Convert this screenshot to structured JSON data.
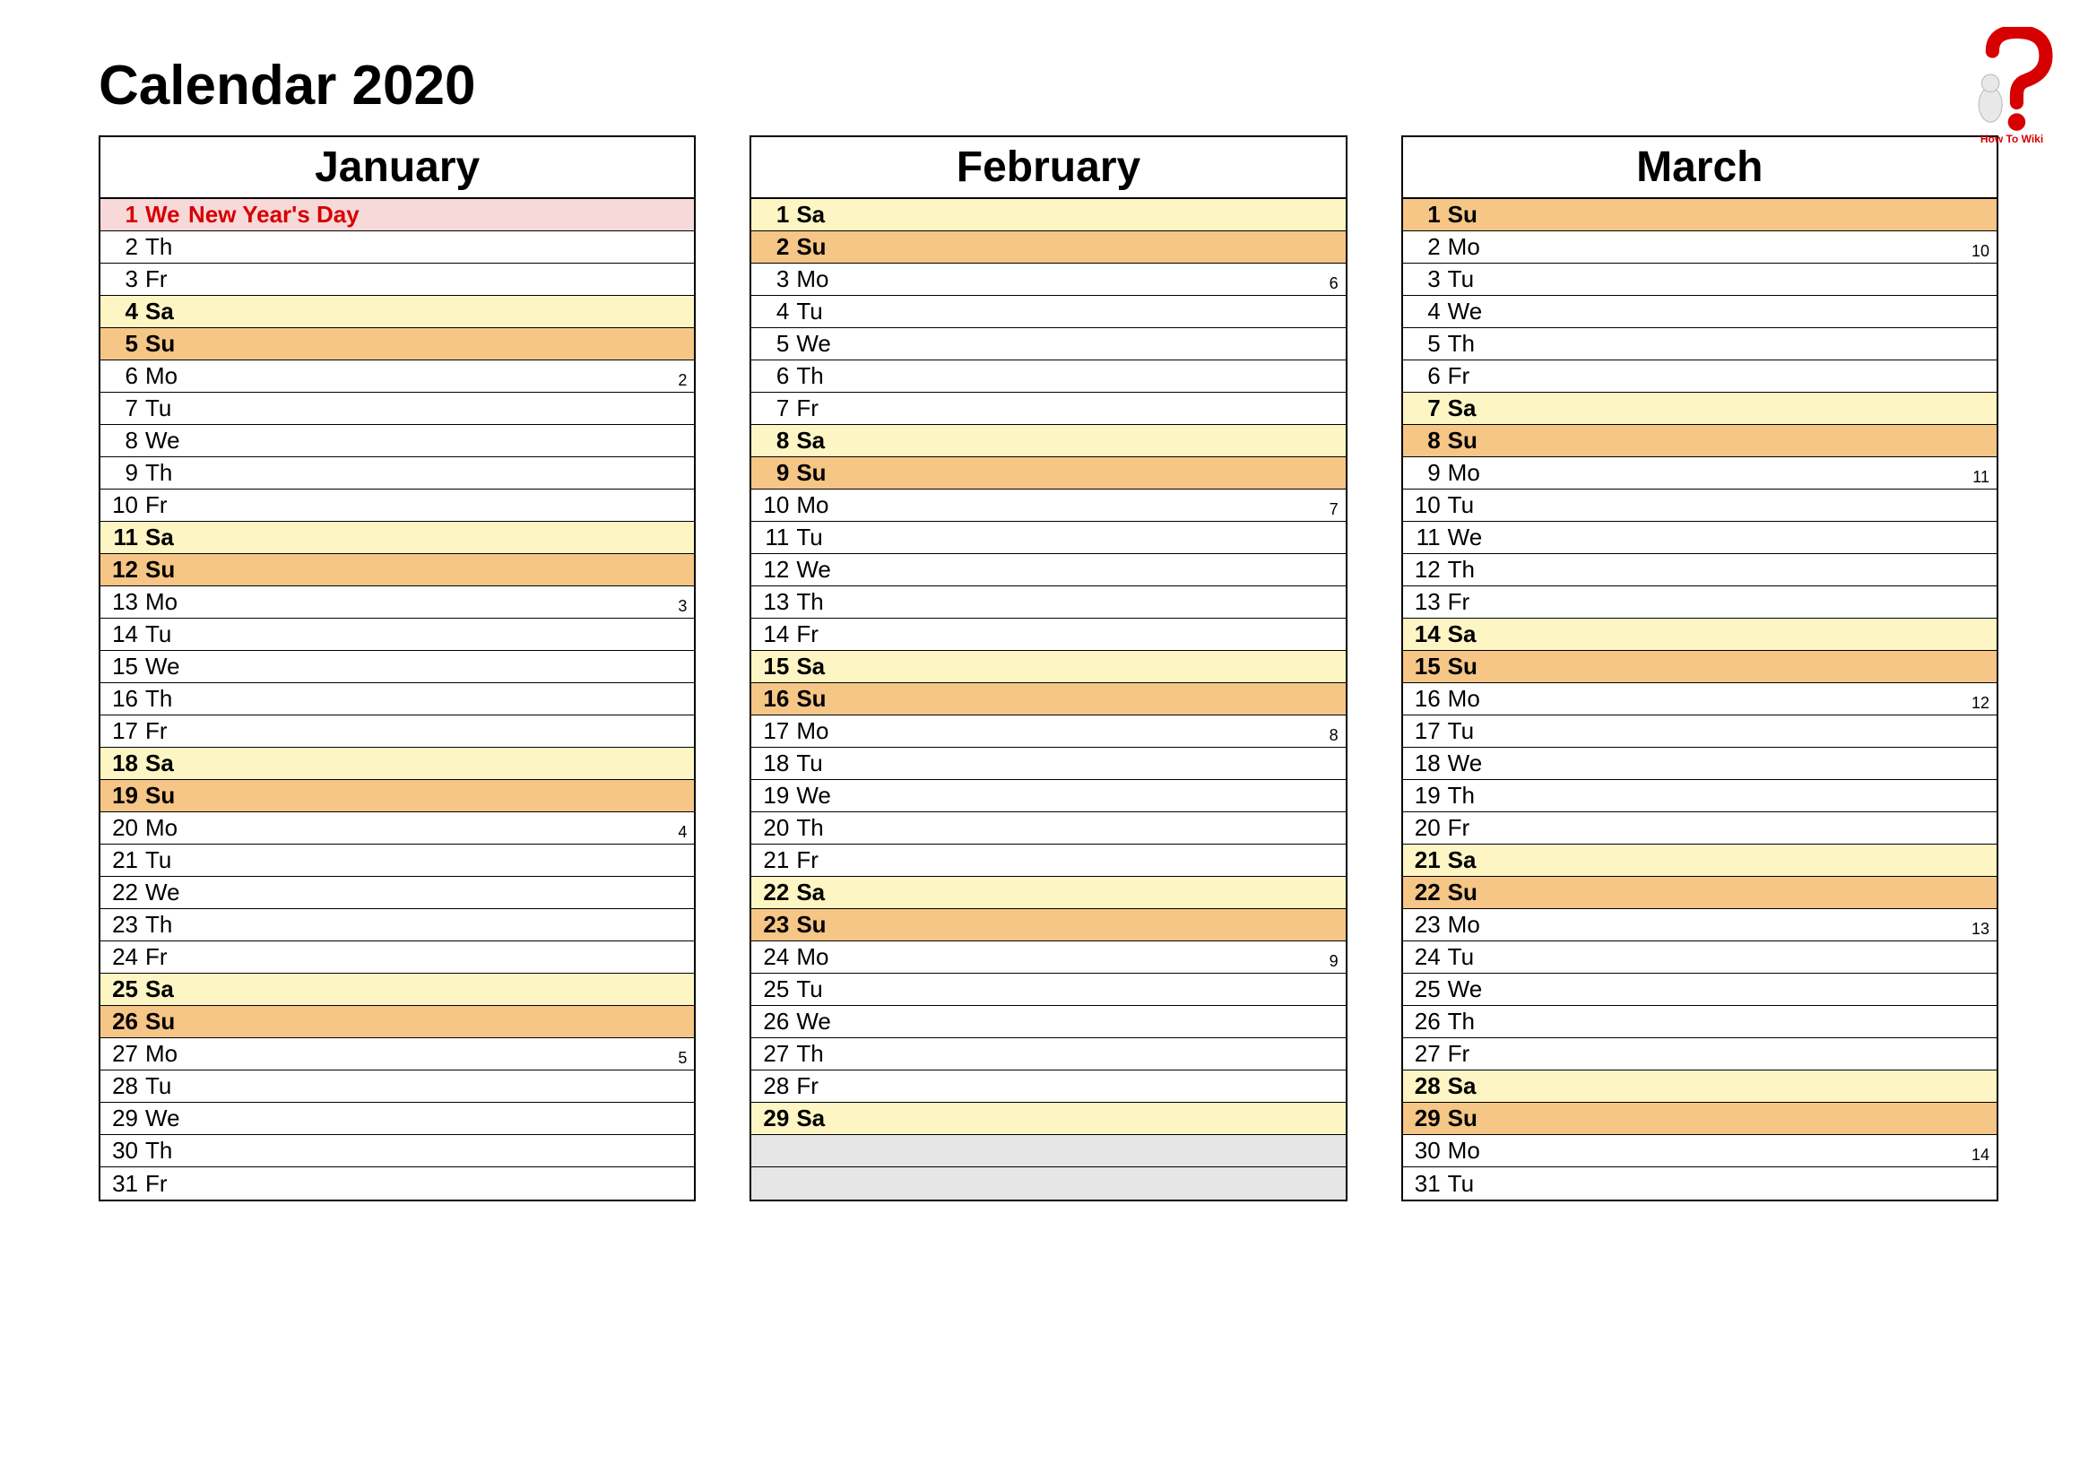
{
  "title": "Calendar 2020",
  "logo_caption": "How To Wiki",
  "months": [
    {
      "name": "January",
      "days": [
        {
          "n": "1",
          "wd": "We",
          "holiday": "New Year's Day",
          "type": "hol",
          "wk": ""
        },
        {
          "n": "2",
          "wd": "Th",
          "holiday": "",
          "type": "",
          "wk": ""
        },
        {
          "n": "3",
          "wd": "Fr",
          "holiday": "",
          "type": "",
          "wk": ""
        },
        {
          "n": "4",
          "wd": "Sa",
          "holiday": "",
          "type": "sa",
          "wk": ""
        },
        {
          "n": "5",
          "wd": "Su",
          "holiday": "",
          "type": "su",
          "wk": ""
        },
        {
          "n": "6",
          "wd": "Mo",
          "holiday": "",
          "type": "",
          "wk": "2"
        },
        {
          "n": "7",
          "wd": "Tu",
          "holiday": "",
          "type": "",
          "wk": ""
        },
        {
          "n": "8",
          "wd": "We",
          "holiday": "",
          "type": "",
          "wk": ""
        },
        {
          "n": "9",
          "wd": "Th",
          "holiday": "",
          "type": "",
          "wk": ""
        },
        {
          "n": "10",
          "wd": "Fr",
          "holiday": "",
          "type": "",
          "wk": ""
        },
        {
          "n": "11",
          "wd": "Sa",
          "holiday": "",
          "type": "sa",
          "wk": ""
        },
        {
          "n": "12",
          "wd": "Su",
          "holiday": "",
          "type": "su",
          "wk": ""
        },
        {
          "n": "13",
          "wd": "Mo",
          "holiday": "",
          "type": "",
          "wk": "3"
        },
        {
          "n": "14",
          "wd": "Tu",
          "holiday": "",
          "type": "",
          "wk": ""
        },
        {
          "n": "15",
          "wd": "We",
          "holiday": "",
          "type": "",
          "wk": ""
        },
        {
          "n": "16",
          "wd": "Th",
          "holiday": "",
          "type": "",
          "wk": ""
        },
        {
          "n": "17",
          "wd": "Fr",
          "holiday": "",
          "type": "",
          "wk": ""
        },
        {
          "n": "18",
          "wd": "Sa",
          "holiday": "",
          "type": "sa",
          "wk": ""
        },
        {
          "n": "19",
          "wd": "Su",
          "holiday": "",
          "type": "su",
          "wk": ""
        },
        {
          "n": "20",
          "wd": "Mo",
          "holiday": "",
          "type": "",
          "wk": "4"
        },
        {
          "n": "21",
          "wd": "Tu",
          "holiday": "",
          "type": "",
          "wk": ""
        },
        {
          "n": "22",
          "wd": "We",
          "holiday": "",
          "type": "",
          "wk": ""
        },
        {
          "n": "23",
          "wd": "Th",
          "holiday": "",
          "type": "",
          "wk": ""
        },
        {
          "n": "24",
          "wd": "Fr",
          "holiday": "",
          "type": "",
          "wk": ""
        },
        {
          "n": "25",
          "wd": "Sa",
          "holiday": "",
          "type": "sa",
          "wk": ""
        },
        {
          "n": "26",
          "wd": "Su",
          "holiday": "",
          "type": "su",
          "wk": ""
        },
        {
          "n": "27",
          "wd": "Mo",
          "holiday": "",
          "type": "",
          "wk": "5"
        },
        {
          "n": "28",
          "wd": "Tu",
          "holiday": "",
          "type": "",
          "wk": ""
        },
        {
          "n": "29",
          "wd": "We",
          "holiday": "",
          "type": "",
          "wk": ""
        },
        {
          "n": "30",
          "wd": "Th",
          "holiday": "",
          "type": "",
          "wk": ""
        },
        {
          "n": "31",
          "wd": "Fr",
          "holiday": "",
          "type": "",
          "wk": ""
        }
      ]
    },
    {
      "name": "February",
      "days": [
        {
          "n": "1",
          "wd": "Sa",
          "holiday": "",
          "type": "sa",
          "wk": ""
        },
        {
          "n": "2",
          "wd": "Su",
          "holiday": "",
          "type": "su",
          "wk": ""
        },
        {
          "n": "3",
          "wd": "Mo",
          "holiday": "",
          "type": "",
          "wk": "6"
        },
        {
          "n": "4",
          "wd": "Tu",
          "holiday": "",
          "type": "",
          "wk": ""
        },
        {
          "n": "5",
          "wd": "We",
          "holiday": "",
          "type": "",
          "wk": ""
        },
        {
          "n": "6",
          "wd": "Th",
          "holiday": "",
          "type": "",
          "wk": ""
        },
        {
          "n": "7",
          "wd": "Fr",
          "holiday": "",
          "type": "",
          "wk": ""
        },
        {
          "n": "8",
          "wd": "Sa",
          "holiday": "",
          "type": "sa",
          "wk": ""
        },
        {
          "n": "9",
          "wd": "Su",
          "holiday": "",
          "type": "su",
          "wk": ""
        },
        {
          "n": "10",
          "wd": "Mo",
          "holiday": "",
          "type": "",
          "wk": "7"
        },
        {
          "n": "11",
          "wd": "Tu",
          "holiday": "",
          "type": "",
          "wk": ""
        },
        {
          "n": "12",
          "wd": "We",
          "holiday": "",
          "type": "",
          "wk": ""
        },
        {
          "n": "13",
          "wd": "Th",
          "holiday": "",
          "type": "",
          "wk": ""
        },
        {
          "n": "14",
          "wd": "Fr",
          "holiday": "",
          "type": "",
          "wk": ""
        },
        {
          "n": "15",
          "wd": "Sa",
          "holiday": "",
          "type": "sa",
          "wk": ""
        },
        {
          "n": "16",
          "wd": "Su",
          "holiday": "",
          "type": "su",
          "wk": ""
        },
        {
          "n": "17",
          "wd": "Mo",
          "holiday": "",
          "type": "",
          "wk": "8"
        },
        {
          "n": "18",
          "wd": "Tu",
          "holiday": "",
          "type": "",
          "wk": ""
        },
        {
          "n": "19",
          "wd": "We",
          "holiday": "",
          "type": "",
          "wk": ""
        },
        {
          "n": "20",
          "wd": "Th",
          "holiday": "",
          "type": "",
          "wk": ""
        },
        {
          "n": "21",
          "wd": "Fr",
          "holiday": "",
          "type": "",
          "wk": ""
        },
        {
          "n": "22",
          "wd": "Sa",
          "holiday": "",
          "type": "sa",
          "wk": ""
        },
        {
          "n": "23",
          "wd": "Su",
          "holiday": "",
          "type": "su",
          "wk": ""
        },
        {
          "n": "24",
          "wd": "Mo",
          "holiday": "",
          "type": "",
          "wk": "9"
        },
        {
          "n": "25",
          "wd": "Tu",
          "holiday": "",
          "type": "",
          "wk": ""
        },
        {
          "n": "26",
          "wd": "We",
          "holiday": "",
          "type": "",
          "wk": ""
        },
        {
          "n": "27",
          "wd": "Th",
          "holiday": "",
          "type": "",
          "wk": ""
        },
        {
          "n": "28",
          "wd": "Fr",
          "holiday": "",
          "type": "",
          "wk": ""
        },
        {
          "n": "29",
          "wd": "Sa",
          "holiday": "",
          "type": "sa",
          "wk": ""
        },
        {
          "n": "",
          "wd": "",
          "holiday": "",
          "type": "empty",
          "wk": ""
        },
        {
          "n": "",
          "wd": "",
          "holiday": "",
          "type": "empty",
          "wk": ""
        }
      ]
    },
    {
      "name": "March",
      "days": [
        {
          "n": "1",
          "wd": "Su",
          "holiday": "",
          "type": "su",
          "wk": ""
        },
        {
          "n": "2",
          "wd": "Mo",
          "holiday": "",
          "type": "",
          "wk": "10"
        },
        {
          "n": "3",
          "wd": "Tu",
          "holiday": "",
          "type": "",
          "wk": ""
        },
        {
          "n": "4",
          "wd": "We",
          "holiday": "",
          "type": "",
          "wk": ""
        },
        {
          "n": "5",
          "wd": "Th",
          "holiday": "",
          "type": "",
          "wk": ""
        },
        {
          "n": "6",
          "wd": "Fr",
          "holiday": "",
          "type": "",
          "wk": ""
        },
        {
          "n": "7",
          "wd": "Sa",
          "holiday": "",
          "type": "sa",
          "wk": ""
        },
        {
          "n": "8",
          "wd": "Su",
          "holiday": "",
          "type": "su",
          "wk": ""
        },
        {
          "n": "9",
          "wd": "Mo",
          "holiday": "",
          "type": "",
          "wk": "11"
        },
        {
          "n": "10",
          "wd": "Tu",
          "holiday": "",
          "type": "",
          "wk": ""
        },
        {
          "n": "11",
          "wd": "We",
          "holiday": "",
          "type": "",
          "wk": ""
        },
        {
          "n": "12",
          "wd": "Th",
          "holiday": "",
          "type": "",
          "wk": ""
        },
        {
          "n": "13",
          "wd": "Fr",
          "holiday": "",
          "type": "",
          "wk": ""
        },
        {
          "n": "14",
          "wd": "Sa",
          "holiday": "",
          "type": "sa",
          "wk": ""
        },
        {
          "n": "15",
          "wd": "Su",
          "holiday": "",
          "type": "su",
          "wk": ""
        },
        {
          "n": "16",
          "wd": "Mo",
          "holiday": "",
          "type": "",
          "wk": "12"
        },
        {
          "n": "17",
          "wd": "Tu",
          "holiday": "",
          "type": "",
          "wk": ""
        },
        {
          "n": "18",
          "wd": "We",
          "holiday": "",
          "type": "",
          "wk": ""
        },
        {
          "n": "19",
          "wd": "Th",
          "holiday": "",
          "type": "",
          "wk": ""
        },
        {
          "n": "20",
          "wd": "Fr",
          "holiday": "",
          "type": "",
          "wk": ""
        },
        {
          "n": "21",
          "wd": "Sa",
          "holiday": "",
          "type": "sa",
          "wk": ""
        },
        {
          "n": "22",
          "wd": "Su",
          "holiday": "",
          "type": "su",
          "wk": ""
        },
        {
          "n": "23",
          "wd": "Mo",
          "holiday": "",
          "type": "",
          "wk": "13"
        },
        {
          "n": "24",
          "wd": "Tu",
          "holiday": "",
          "type": "",
          "wk": ""
        },
        {
          "n": "25",
          "wd": "We",
          "holiday": "",
          "type": "",
          "wk": ""
        },
        {
          "n": "26",
          "wd": "Th",
          "holiday": "",
          "type": "",
          "wk": ""
        },
        {
          "n": "27",
          "wd": "Fr",
          "holiday": "",
          "type": "",
          "wk": ""
        },
        {
          "n": "28",
          "wd": "Sa",
          "holiday": "",
          "type": "sa",
          "wk": ""
        },
        {
          "n": "29",
          "wd": "Su",
          "holiday": "",
          "type": "su",
          "wk": ""
        },
        {
          "n": "30",
          "wd": "Mo",
          "holiday": "",
          "type": "",
          "wk": "14"
        },
        {
          "n": "31",
          "wd": "Tu",
          "holiday": "",
          "type": "",
          "wk": ""
        }
      ]
    }
  ]
}
